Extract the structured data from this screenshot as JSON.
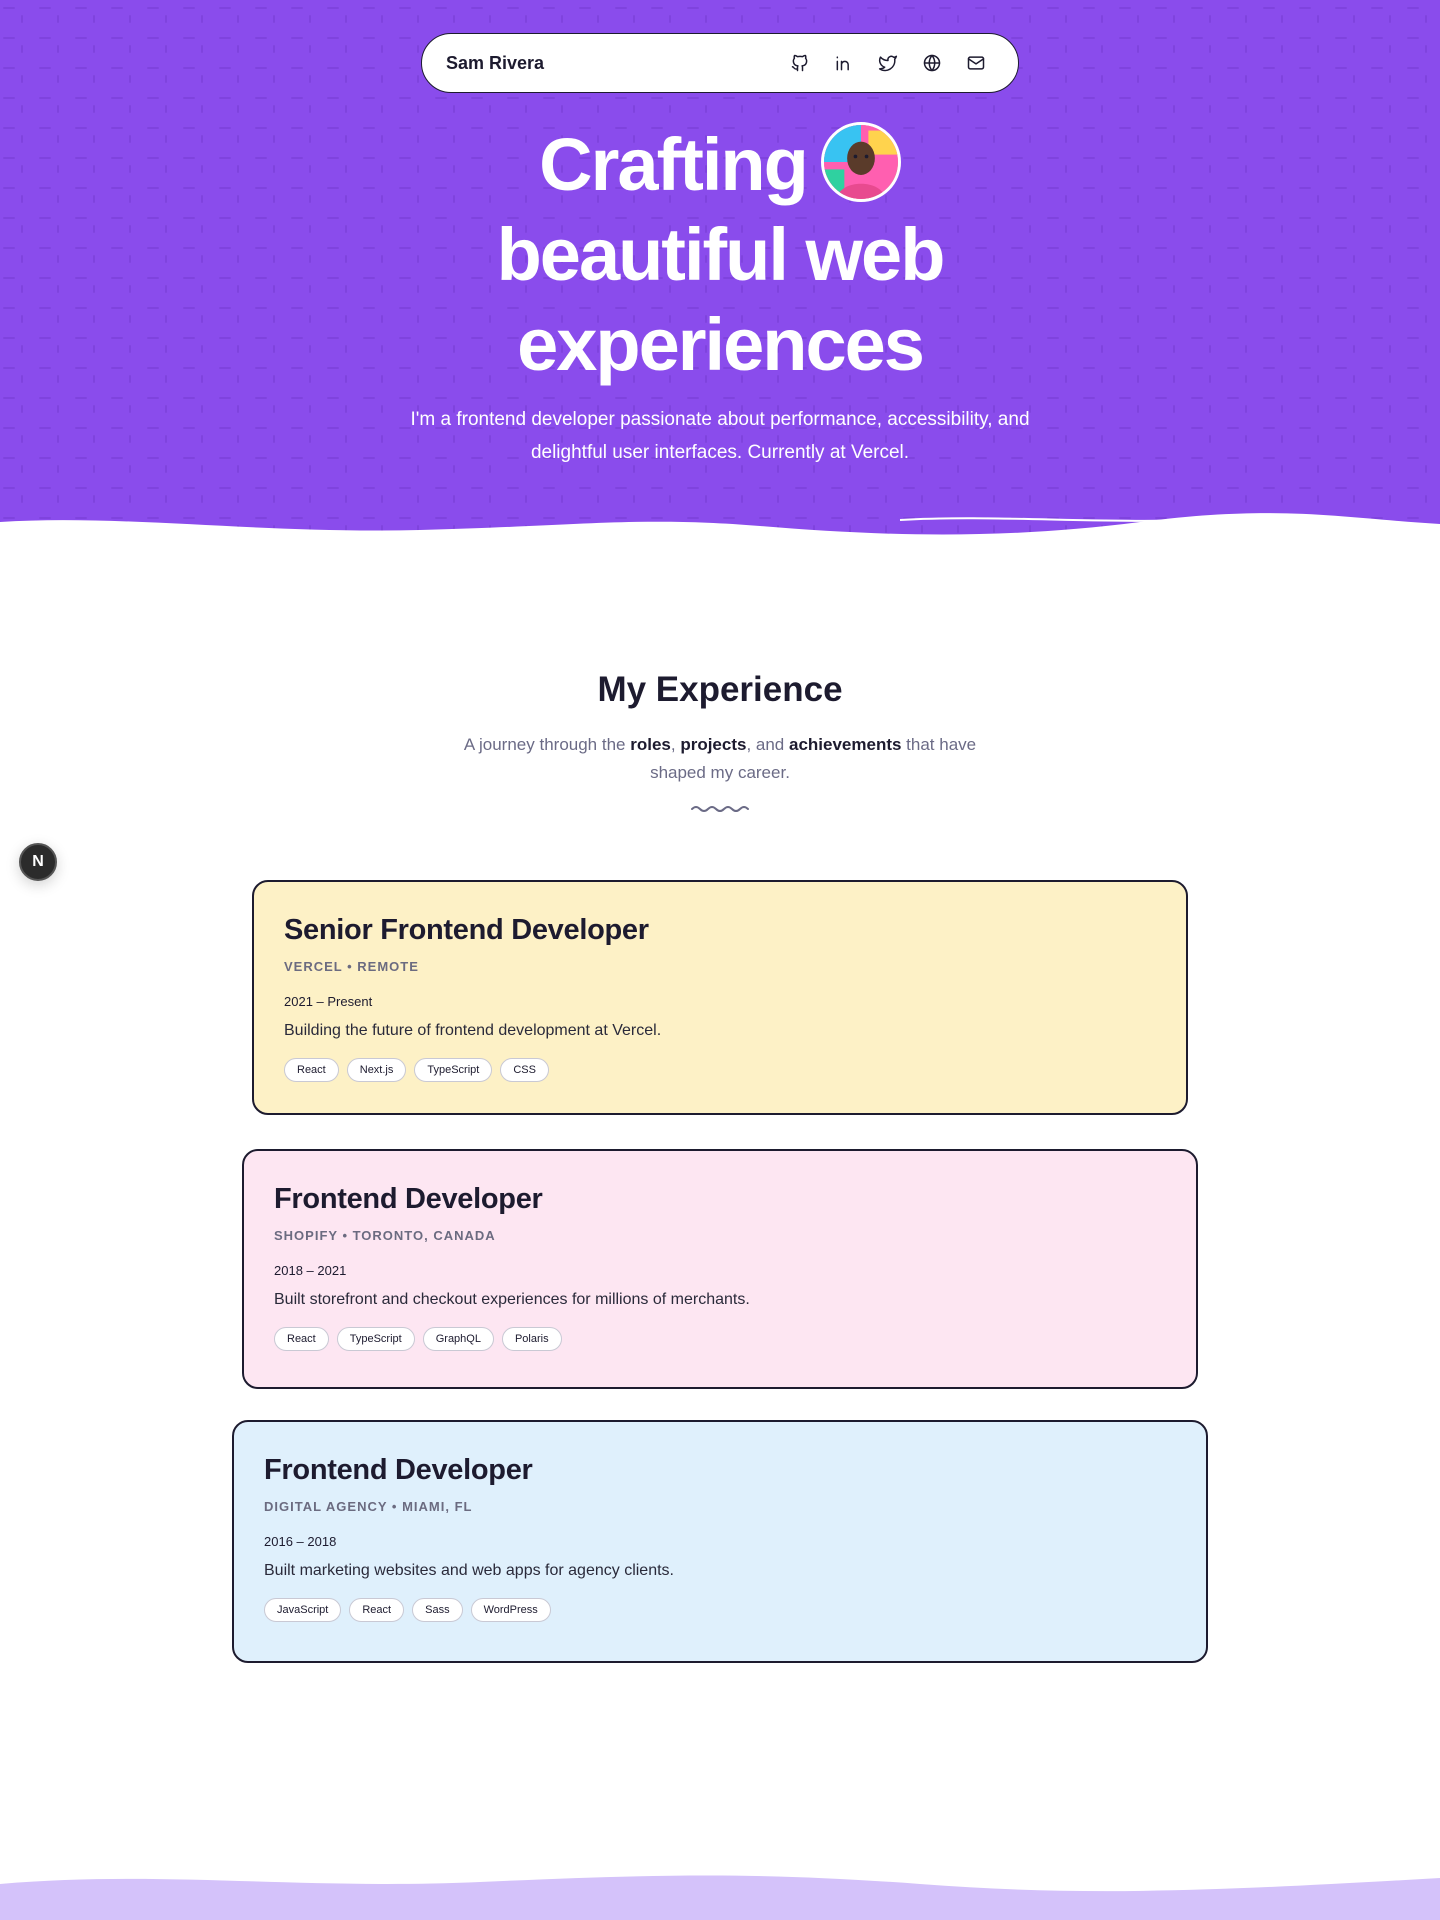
{
  "nav": {
    "name": "Sam Rivera",
    "icons": [
      "github-icon",
      "linkedin-icon",
      "twitter-icon",
      "globe-icon",
      "mail-icon"
    ]
  },
  "hero": {
    "title_line1": "Crafting",
    "title_line2": "beautiful web",
    "title_line3": "experiences",
    "subtitle": "I'm a frontend developer passionate about performance, accessibility, and delightful user interfaces. Currently at Vercel."
  },
  "experience": {
    "title": "My Experience",
    "subtitle_pre": "A journey through the ",
    "subtitle_b1": "roles",
    "subtitle_sep1": ", ",
    "subtitle_b2": "projects",
    "subtitle_sep2": ", and ",
    "subtitle_b3": "achievements",
    "subtitle_post": " that have shaped my career.",
    "cards": [
      {
        "title": "Senior Frontend Developer",
        "company": "VERCEL • REMOTE",
        "dates": "2021 – Present",
        "description": "Building the future of frontend development at Vercel.",
        "tags": [
          "React",
          "Next.js",
          "TypeScript",
          "CSS"
        ]
      },
      {
        "title": "Frontend Developer",
        "company": "SHOPIFY • TORONTO, CANADA",
        "dates": "2018 – 2021",
        "description": "Built storefront and checkout experiences for millions of merchants.",
        "tags": [
          "React",
          "TypeScript",
          "GraphQL",
          "Polaris"
        ]
      },
      {
        "title": "Frontend Developer",
        "company": "DIGITAL AGENCY • MIAMI, FL",
        "dates": "2016 – 2018",
        "description": "Built marketing websites and web apps for agency clients.",
        "tags": [
          "JavaScript",
          "React",
          "Sass",
          "WordPress"
        ]
      }
    ]
  },
  "badge": {
    "label": "N"
  },
  "colors": {
    "hero_bg": "#8a4cec",
    "card1_bg": "#fdf1c6",
    "card2_bg": "#fde6f2",
    "card3_bg": "#dff0fc",
    "footer_wave": "#d4c2fa"
  }
}
